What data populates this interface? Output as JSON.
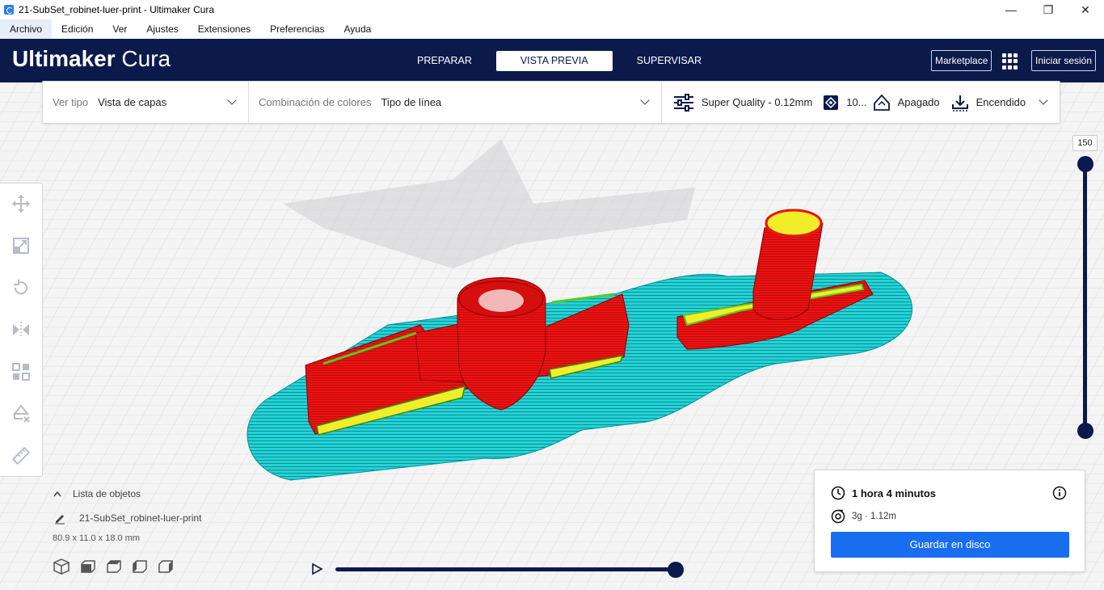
{
  "window": {
    "title": "21-SubSet_robinet-luer-print - Ultimaker Cura",
    "controls": {
      "minimize": "—",
      "maximize": "❐",
      "close": "✕"
    }
  },
  "menu": [
    "Archivo",
    "Edición",
    "Ver",
    "Ajustes",
    "Extensiones",
    "Preferencias",
    "Ayuda"
  ],
  "header": {
    "logo_strong": "Ultimaker",
    "logo_light": "Cura",
    "stages": [
      "PREPARAR",
      "VISTA PREVIA",
      "SUPERVISAR"
    ],
    "active_stage": "VISTA PREVIA",
    "marketplace": "Marketplace",
    "signin": "Iniciar sesión"
  },
  "view_settings": {
    "view_type_label": "Ver tipo",
    "view_type_value": "Vista de capas",
    "color_scheme_label": "Combinación de colores",
    "color_scheme_value": "Tipo de línea"
  },
  "print_setup": {
    "profile": "Super Quality - 0.12mm",
    "infill": "10...",
    "support": "Apagado",
    "adhesion": "Encendido"
  },
  "layer_slider": {
    "value": "150"
  },
  "object_list": {
    "header": "Lista de objetos",
    "item": "21-SubSet_robinet-luer-print",
    "dimensions": "80.9 x 11.0 x 18.0 mm"
  },
  "print_info": {
    "time": "1 hora 4 minutos",
    "material": "3g · 1.12m",
    "save": "Guardar en disco"
  },
  "colors": {
    "header_bg": "#0b1a4a",
    "accent": "#196ef0",
    "skirt": "#22d3d6",
    "wall": "#ee1111",
    "infill": "#f0ee2a",
    "inner_wall": "#55cc22"
  },
  "icons": {
    "tools": [
      "move-icon",
      "scale-icon",
      "rotate-icon",
      "mirror-icon",
      "per-model-settings-icon",
      "support-blocker-icon",
      "measure-icon"
    ],
    "views": [
      "3d-view-icon",
      "front-view-icon",
      "top-view-icon",
      "left-view-icon",
      "right-view-icon"
    ]
  }
}
